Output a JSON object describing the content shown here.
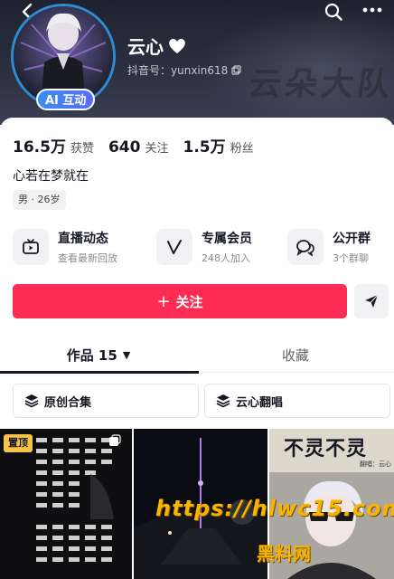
{
  "header": {
    "watermark": "云朵大队",
    "name": "云心",
    "douyin_id_label": "抖音号：yunxin618",
    "ai_badge": "AI 互动",
    "accent_color": "#2f8bd0"
  },
  "stats": [
    {
      "value": "16.5万",
      "label": "获赞"
    },
    {
      "value": "640",
      "label": "关注"
    },
    {
      "value": "1.5万",
      "label": "粉丝"
    }
  ],
  "bio": "心若在梦就在",
  "tag": "男 · 26岁",
  "features": [
    {
      "title": "直播动态",
      "sub": "查看最新回放",
      "icon": "tv-icon"
    },
    {
      "title": "专属会员",
      "sub": "248人加入",
      "icon": "v-icon"
    },
    {
      "title": "公开群",
      "sub": "3个群聊",
      "icon": "chat-icon"
    }
  ],
  "follow": {
    "plus": "+",
    "label": "关注",
    "color": "#fe2c55"
  },
  "tabs": {
    "works_label": "作品 15",
    "works_caret": "▼",
    "fav_label": "收藏"
  },
  "collections": [
    {
      "label": "原创合集",
      "icon": "stack-icon"
    },
    {
      "label": "云心翻唱",
      "icon": "stack-icon"
    }
  ],
  "grid": {
    "pin_badge": "置顶",
    "cell3_title": "不灵不灵",
    "cell3_sub": "翻唱：云心"
  },
  "overlay_watermark": {
    "line1": "https://hlwc15.com",
    "line2": "黑料网"
  }
}
